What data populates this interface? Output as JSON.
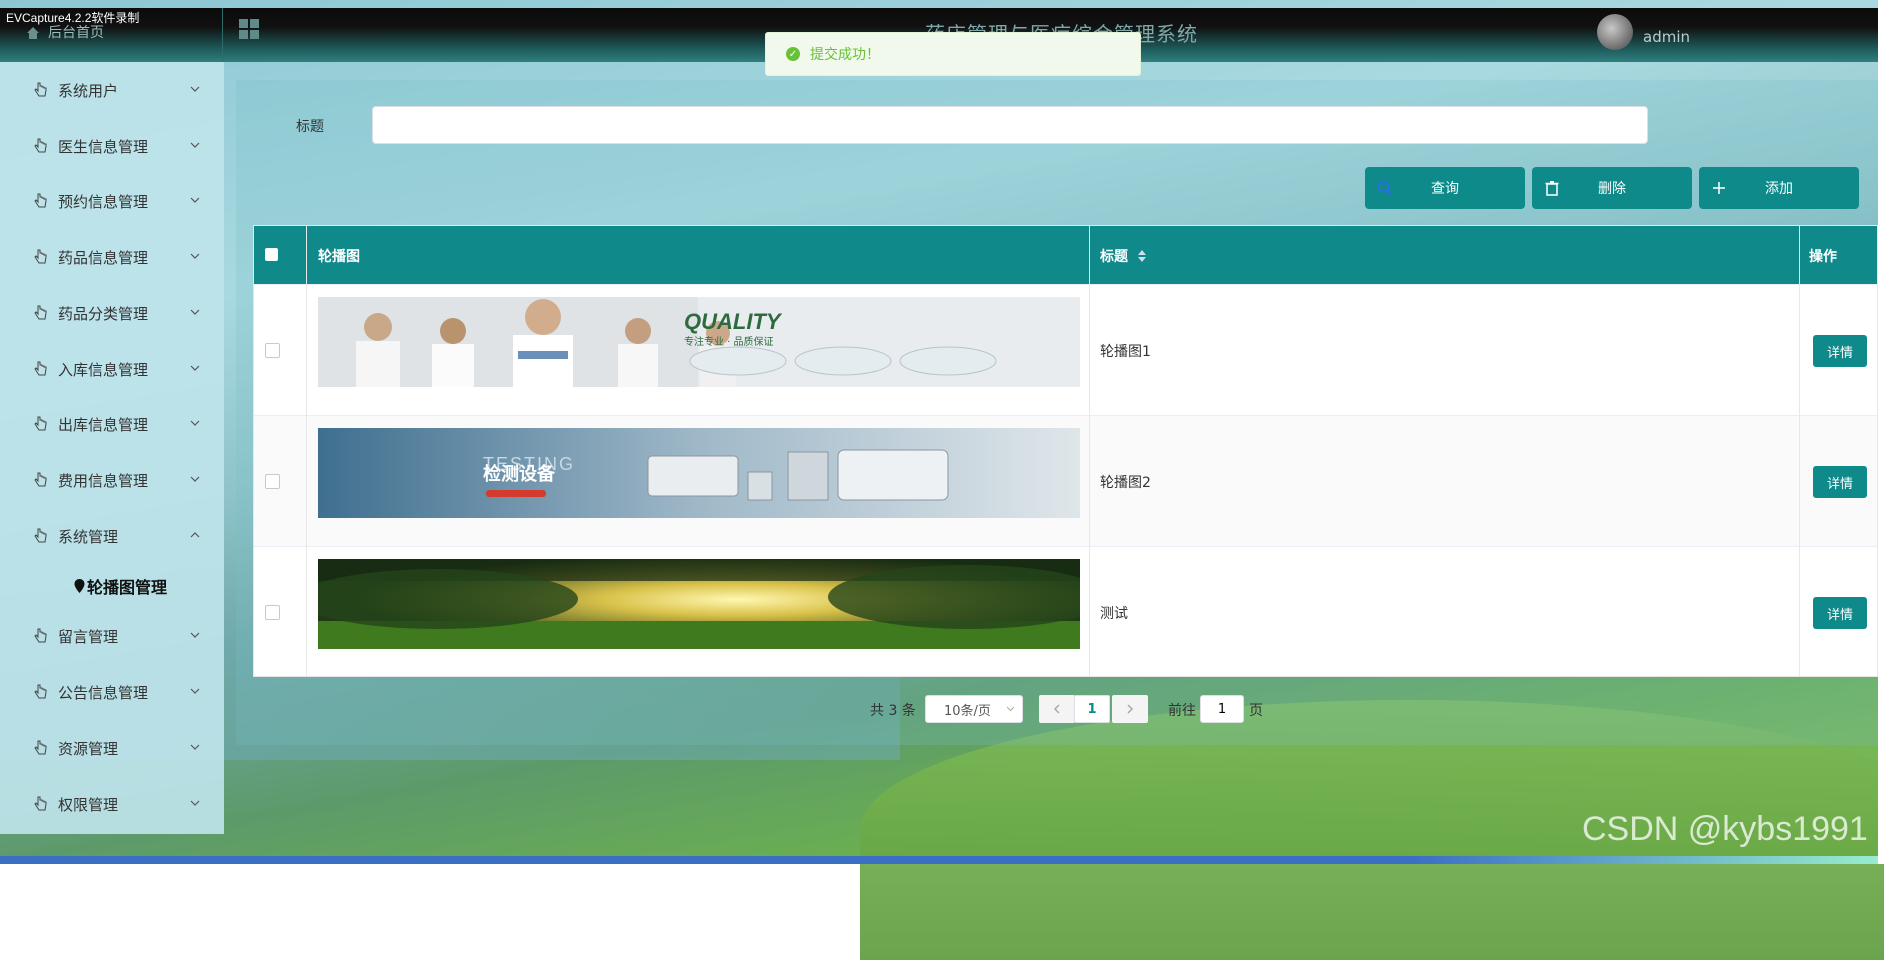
{
  "recorder": {
    "title": "EVCapture4.2.2软件录制"
  },
  "header": {
    "home_label": "后台首页",
    "system_title": "药店管理与医疗综合管理系统",
    "user": "admin"
  },
  "toast": {
    "message": "提交成功！"
  },
  "sidebar": {
    "items": [
      {
        "label": "系统用户",
        "expanded": false
      },
      {
        "label": "医生信息管理",
        "expanded": false
      },
      {
        "label": "预约信息管理",
        "expanded": false
      },
      {
        "label": "药品信息管理",
        "expanded": false
      },
      {
        "label": "药品分类管理",
        "expanded": false
      },
      {
        "label": "入库信息管理",
        "expanded": false
      },
      {
        "label": "出库信息管理",
        "expanded": false
      },
      {
        "label": "费用信息管理",
        "expanded": false
      },
      {
        "label": "系统管理",
        "expanded": true
      },
      {
        "label": "留言管理",
        "expanded": false
      },
      {
        "label": "公告信息管理",
        "expanded": false
      },
      {
        "label": "资源管理",
        "expanded": false
      },
      {
        "label": "权限管理",
        "expanded": false
      }
    ],
    "active_sub_item": "轮播图管理"
  },
  "search": {
    "label": "标题",
    "value": "",
    "placeholder": ""
  },
  "toolbar": {
    "query_label": "查询",
    "delete_label": "删除",
    "add_label": "添加"
  },
  "table": {
    "headers": {
      "image": "轮播图",
      "title": "标题",
      "actions": "操作"
    },
    "rows": [
      {
        "title": "轮播图1",
        "action": "详情",
        "image_caption": "QUALITY",
        "image_subtext": "专注专业 · 品质保证"
      },
      {
        "title": "轮播图2",
        "action": "详情",
        "image_caption": "检测设备",
        "image_subtext": "TESTING"
      },
      {
        "title": "测试",
        "action": "详情",
        "image_caption": "",
        "image_subtext": ""
      }
    ]
  },
  "pagination": {
    "total_text": "共 3 条",
    "page_size": "10条/页",
    "current_page": "1",
    "goto_label": "前往",
    "goto_value": "1",
    "page_suffix": "页"
  },
  "watermark": "CSDN @kybs1991",
  "colors": {
    "accent": "#0e8a8a",
    "success": "#67c23a"
  }
}
